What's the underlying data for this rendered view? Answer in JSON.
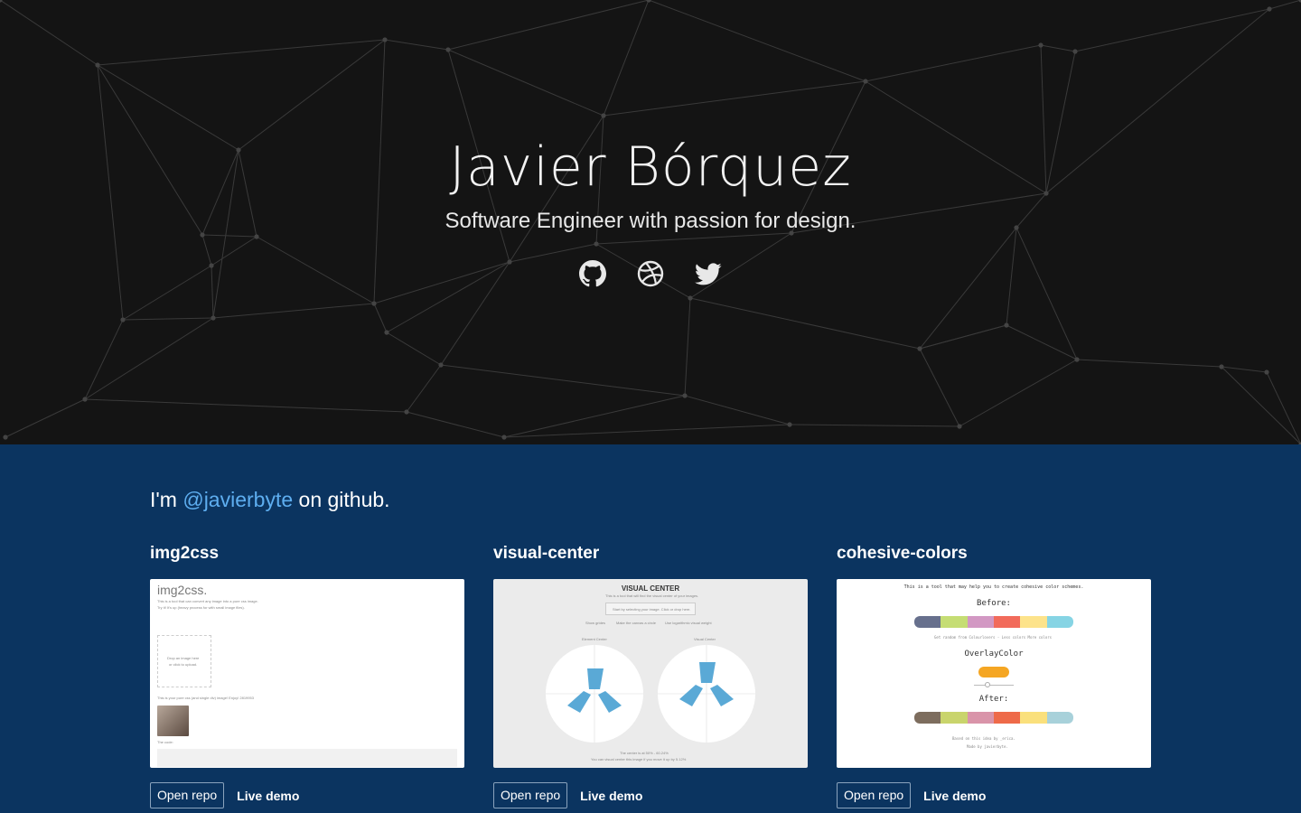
{
  "hero": {
    "title": "Javier Bórquez",
    "subtitle": "Software Engineer with passion for design.",
    "social": [
      {
        "name": "github-icon"
      },
      {
        "name": "dribbble-icon"
      },
      {
        "name": "twitter-icon"
      }
    ]
  },
  "intro": {
    "prefix": "I'm ",
    "handle": "@javierbyte",
    "suffix": " on github."
  },
  "projects": [
    {
      "title": "img2css",
      "open_repo": "Open repo",
      "live_demo": "Live demo",
      "thumb": {
        "title": "img2css.",
        "line1": "This is a tool that can convert any image into a pure css image.",
        "line2": "Try it! It's up (heavy process for with small image files).",
        "drop": "Drop an image here",
        "drop2": "or click to upload.",
        "result": "This is your pure css (and single div) image! Enjoy! 2819953",
        "code_label": "The code:"
      }
    },
    {
      "title": "visual-center",
      "open_repo": "Open repo",
      "live_demo": "Live demo",
      "thumb": {
        "title": "VISUAL CENTER",
        "line1": "This is a tool that will find the visual center of your images.",
        "select": "Start by selecting your image. Click or drop here.",
        "opt1": "Show grides",
        "opt2": "Make the canvas a circle",
        "opt3": "Use logarithmic visual weight",
        "label_left": "Element Center",
        "label_right": "Visual Center",
        "foot1": "The center is at 50% - 60.24%",
        "foot2": "You can visual center this image if you move it up by 5.12%"
      }
    },
    {
      "title": "cohesive-colors",
      "open_repo": "Open repo",
      "live_demo": "Live demo",
      "thumb": {
        "title": "This is a tool that may help you to create cohesive color schemes.",
        "before": "Before:",
        "controls": "Get random from Colourlovers  -  Less colors  More colors",
        "overlay": "OverlayColor",
        "after": "After:",
        "credit1": "Based on this idea by _erica.",
        "credit2": "Made by javierbyte.",
        "before_colors": [
          "#67708d",
          "#c5dd74",
          "#d298c3",
          "#f26b5b",
          "#fde38b",
          "#86d4e4"
        ],
        "after_colors": [
          "#7d6d5e",
          "#c9d46c",
          "#d994a9",
          "#ee6a49",
          "#fae07c",
          "#a8d1da"
        ],
        "overlay_color": "#f5a623"
      }
    }
  ],
  "colors": {
    "hero_bg": "#141414",
    "section_bg": "#0b3460",
    "link": "#5eaef0",
    "thumb_blue": "#5aa9d6"
  }
}
